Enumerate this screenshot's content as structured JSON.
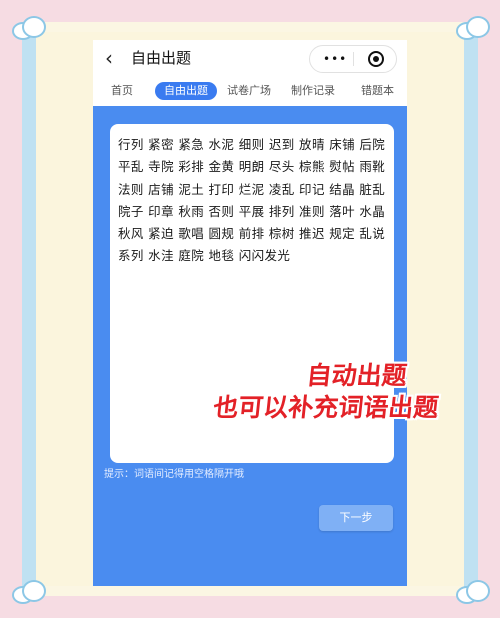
{
  "header": {
    "title": "自由出题",
    "back_icon": "chevron-left-icon",
    "more_icon": "more-dots-icon",
    "close_icon": "target-circle-icon"
  },
  "tabs": [
    {
      "label": "首页",
      "active": false
    },
    {
      "label": "自由出题",
      "active": true
    },
    {
      "label": "试卷广场",
      "active": false
    },
    {
      "label": "制作记录",
      "active": false
    },
    {
      "label": "错题本",
      "active": false
    }
  ],
  "editor": {
    "value": "行列 紧密 紧急 水泥 细则 迟到 放晴 床铺 后院 平乱 寺院 彩排 金黄 明朗 尽头 棕熊 熨帖 雨靴 法则 店铺 泥土 打印 烂泥 凌乱 印记 结晶 脏乱 院子 印章 秋雨 否则 平展 排列 准则 落叶 水晶 秋风 紧迫 歌唱 圆规 前排 棕树 推迟 规定 乱说 系列 水洼 庭院 地毯 闪闪发光"
  },
  "hint": "提示：词语间记得用空格隔开哦",
  "next_button": "下一步",
  "overlay": {
    "line1": "自动出题",
    "line2": "也可以补充词语出题"
  },
  "colors": {
    "screen_bg": "#4a8cf0",
    "tab_active": "#3a7bf0",
    "overlay_text": "#e32127",
    "background": "#f6dce3"
  }
}
